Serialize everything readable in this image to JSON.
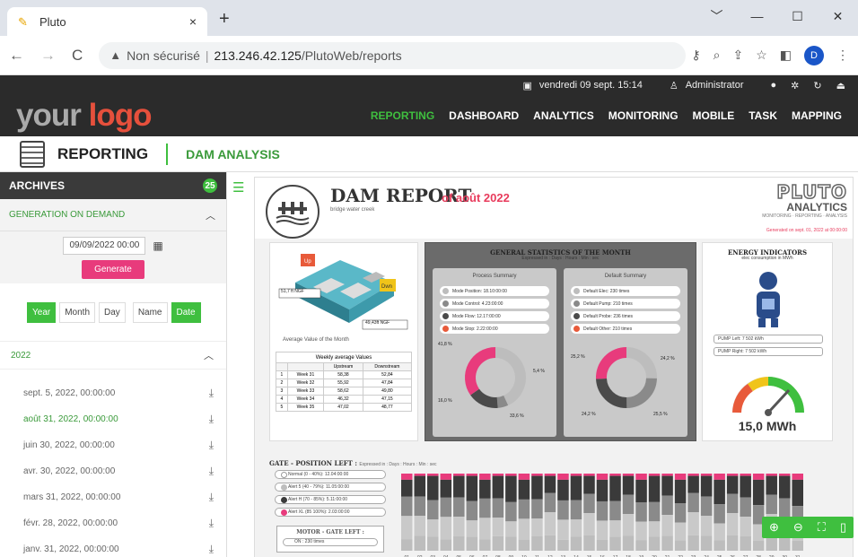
{
  "browser": {
    "tab_title": "Pluto",
    "tab_close": "×",
    "new_tab": "+",
    "window_controls": [
      "﹀",
      "—",
      "☐",
      "✕"
    ],
    "security_label": "Non sécurisé",
    "url_host": "213.246.42.125",
    "url_path": "/PlutoWeb/reports",
    "profile_initial": "D"
  },
  "topbar": {
    "datetime": "vendredi 09 sept. 15:14",
    "user": "Administrator"
  },
  "header": {
    "logo_your": "your",
    "logo_logo": "logo",
    "nav": [
      "REPORTING",
      "DASHBOARD",
      "ANALYTICS",
      "MONITORING",
      "MOBILE",
      "TASK",
      "MAPPING"
    ],
    "nav_active": "REPORTING"
  },
  "subheader": {
    "title": "REPORTING",
    "sub": "DAM ANALYSIS"
  },
  "sidebar": {
    "archives_title": "ARCHIVES",
    "archives_badge": "25",
    "generation_title": "GENERATION ON DEMAND",
    "date_value": "09/09/2022 00:00",
    "generate_label": "Generate",
    "period_toggles": [
      "Year",
      "Month",
      "Day"
    ],
    "period_active": "Year",
    "type_toggles": [
      "Name",
      "Date"
    ],
    "type_active": "Date",
    "year_label": "2022",
    "archives": [
      "sept. 5, 2022, 00:00:00",
      "août 31, 2022, 00:00:00",
      "juin 30, 2022, 00:00:00",
      "avr. 30, 2022, 00:00:00",
      "mars 31, 2022, 00:00:00",
      "févr. 28, 2022, 00:00:00",
      "janv. 31, 2022, 00:00:00"
    ],
    "selected_index": 1
  },
  "report": {
    "title": "DAM REPORT",
    "subtitle": "bridge water creek",
    "month": "of août 2022",
    "brand_top": "PLUTO",
    "brand_bottom": "ANALYTICS",
    "brand_tagline": "MONITORING · REPORTING · ANALYSIS",
    "generated": "Generated on sept. 01, 2022 at 00:00:00",
    "left_panel": {
      "level_high": "51,7 ft NGF",
      "level_low": "49,43ft NGF",
      "avg_label": "Average Value of the Month",
      "up_tag": "Up",
      "down_tag": "Dwn",
      "table_caption": "Weekly average Values",
      "headers": [
        "",
        "Upstream",
        "Downstream"
      ],
      "rows": [
        [
          "1",
          "Week 31",
          "58,38",
          "52,84"
        ],
        [
          "2",
          "Week 32",
          "55,92",
          "47,84"
        ],
        [
          "3",
          "Week 33",
          "58,62",
          "49,80"
        ],
        [
          "4",
          "Week 34",
          "46,32",
          "47,15"
        ],
        [
          "5",
          "Week 35",
          "47,02",
          "48,77"
        ]
      ]
    },
    "general": {
      "title": "GENERAL STATISTICS OF THE MONTH",
      "sub": "Expressed in : Days : Hours : Min : sec",
      "process_title": "Process Summary",
      "process_items": [
        {
          "label": "Mode Position: 18.10:00:00",
          "color": "#bdbdbd"
        },
        {
          "label": "Mode Control: 4.23:00:00",
          "color": "#8a8a8a"
        },
        {
          "label": "Mode Flow: 12.17:00:00",
          "color": "#4a4a4a"
        },
        {
          "label": "Mode Stop: 2.22:00:00",
          "color": "#e85a3a"
        }
      ],
      "process_pcts": [
        "41,8 %",
        "5,4 %",
        "16,0 %",
        "33,6 %"
      ],
      "process_values": [
        41.8,
        5.4,
        16.0,
        33.6
      ],
      "default_title": "Default Summary",
      "default_items": [
        {
          "label": "Default Elec: 230 times",
          "color": "#bdbdbd"
        },
        {
          "label": "Default Pump: 210 times",
          "color": "#8a8a8a"
        },
        {
          "label": "Default Probe: 236 times",
          "color": "#4a4a4a"
        },
        {
          "label": "Default Other: 210 times",
          "color": "#e85a3a"
        }
      ],
      "default_pcts": [
        "25,2 %",
        "24,2 %",
        "24,2 %",
        "25,5 %"
      ],
      "default_values": [
        25.2,
        24.2,
        24.2,
        25.5
      ]
    },
    "energy": {
      "title": "ENERGY INDICATORS",
      "sub": "elec consumption in MWh",
      "pump_left": "PUMP Left: 7 502 kWh",
      "pump_right": "PUMP Right: 7 502 kWh",
      "total": "15,0 MWh"
    },
    "gate": {
      "title": "GATE - POSITION LEFT :",
      "title_sub": "Expressed in : Days : Hours : Min : sec",
      "items": [
        {
          "label": "Normal (0 - 40%): 12.04:00:00",
          "color": "#ffffff"
        },
        {
          "label": "Alert 5 (40 - 79%): 11.05:00:00",
          "color": "#bdbdbd"
        },
        {
          "label": "Alert H (70 - 85%): 5.11:00:00",
          "color": "#3a3a3a"
        },
        {
          "label": "Alert XL (85 100%): 2.03:00:00",
          "color": "#e83b7c"
        }
      ],
      "motor_title": "MOTOR - GATE LEFT :",
      "motor_item": "ON : 230 times",
      "days": [
        "01",
        "02",
        "03",
        "04",
        "05",
        "06",
        "07",
        "08",
        "09",
        "10",
        "11",
        "12",
        "13",
        "14",
        "15",
        "16",
        "17",
        "18",
        "19",
        "20",
        "21",
        "22",
        "23",
        "24",
        "25",
        "26",
        "27",
        "28",
        "29",
        "30",
        "31"
      ]
    },
    "zoom_icons": [
      "zoom-in-icon",
      "zoom-out-icon",
      "fullscreen-icon",
      "delete-icon"
    ]
  },
  "colors": {
    "accent_green": "#3fbf3f",
    "accent_pink": "#e83b7c",
    "logo_orange": "#e6503c",
    "dark_header": "#2b2b2b"
  }
}
